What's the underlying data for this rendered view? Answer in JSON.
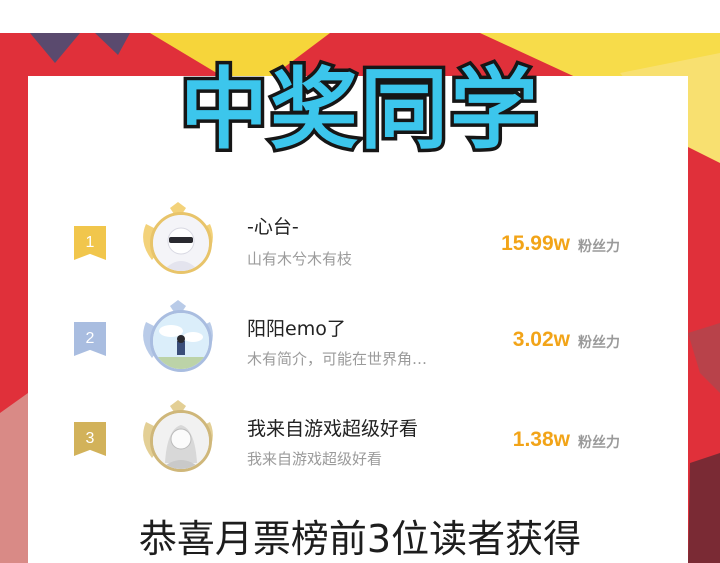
{
  "banner": {
    "title": "中奖同学"
  },
  "ranking": [
    {
      "rank": "1",
      "name": "-心台-",
      "subtitle": "山有木兮木有枝",
      "score": "15.99w",
      "unit": "粉丝力",
      "rank_color": "#f1c64c"
    },
    {
      "rank": "2",
      "name": "阳阳emo了",
      "subtitle": "木有简介，可能在世界角…",
      "score": "3.02w",
      "unit": "粉丝力",
      "rank_color": "#a9bde0"
    },
    {
      "rank": "3",
      "name": "我来自游戏超级好看",
      "subtitle": "我来自游戏超级好看",
      "score": "1.38w",
      "unit": "粉丝力",
      "rank_color": "#d2b25a"
    }
  ],
  "footer": {
    "text": "恭喜月票榜前3位读者获得"
  },
  "colors": {
    "background": "#e0303a",
    "banner_fill": "#3cc6ec",
    "score": "#f2a418"
  }
}
